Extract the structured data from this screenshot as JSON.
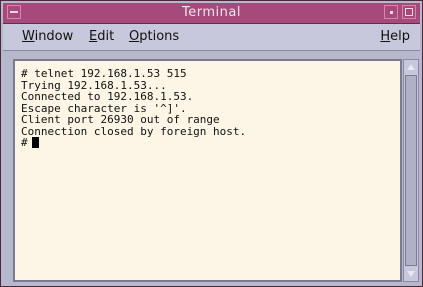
{
  "window": {
    "title": "Terminal",
    "menu": [
      {
        "label": "Window",
        "mnemonic": "W",
        "rest": "indow"
      },
      {
        "label": "Edit",
        "mnemonic": "E",
        "rest": "dit"
      },
      {
        "label": "Options",
        "mnemonic": "O",
        "rest": "ptions"
      },
      {
        "label": "Help",
        "mnemonic": "H",
        "rest": "elp"
      }
    ]
  },
  "terminal": {
    "lines": [
      "# telnet 192.168.1.53 515",
      "Trying 192.168.1.53...",
      "Connected to 192.168.1.53.",
      "Escape character is '^]'.",
      "Client port 26930 out of range",
      "Connection closed by foreign host.",
      "#"
    ]
  },
  "icons": {
    "window_menu": "window-menu-icon",
    "minimize": "minimize-icon",
    "maximize": "maximize-icon",
    "scroll_up": "scroll-up-arrow-icon",
    "scroll_down": "scroll-down-arrow-icon"
  },
  "colors": {
    "titlebar": "#a54a7a",
    "terminal_bg": "#fdf6e6",
    "chrome": "#c8c8dc"
  }
}
